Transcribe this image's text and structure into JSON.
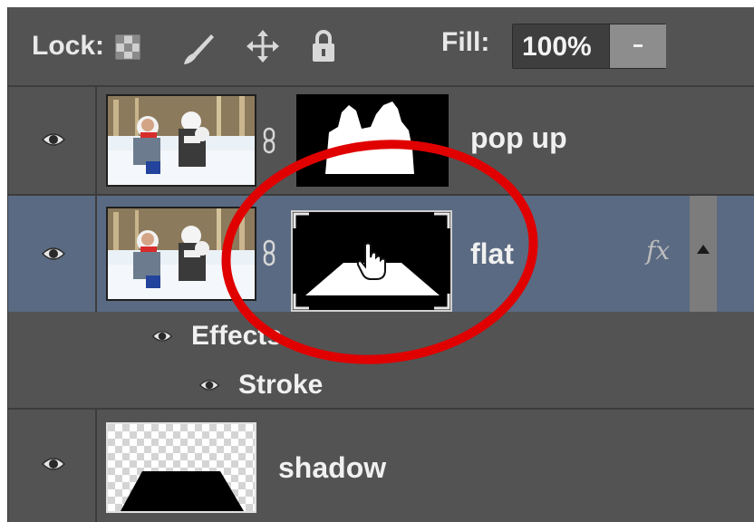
{
  "lockbar": {
    "lock_label": "Lock:",
    "icons": [
      "lock-transparent-pixels-icon",
      "lock-image-pixels-icon",
      "lock-position-icon",
      "lock-all-icon"
    ],
    "fill_label": "Fill:",
    "fill_value": "100%"
  },
  "layers": [
    {
      "name": "pop up",
      "thumbnail": "snowman-photo",
      "mask": "popup-silhouette-mask",
      "visible": true
    },
    {
      "name": "flat",
      "thumbnail": "snowman-photo",
      "mask": "trapezoid-mask",
      "visible": true,
      "selected": true,
      "fx": "fx",
      "effects": {
        "label": "Effects",
        "items": [
          {
            "label": "Stroke"
          }
        ]
      }
    },
    {
      "name": "shadow",
      "thumbnail": "shadow-trapezoid",
      "visible": true
    }
  ],
  "colors": {
    "panel_bg": "#535353",
    "selected_row": "#5a6a82",
    "annotation_circle": "#e00000"
  }
}
